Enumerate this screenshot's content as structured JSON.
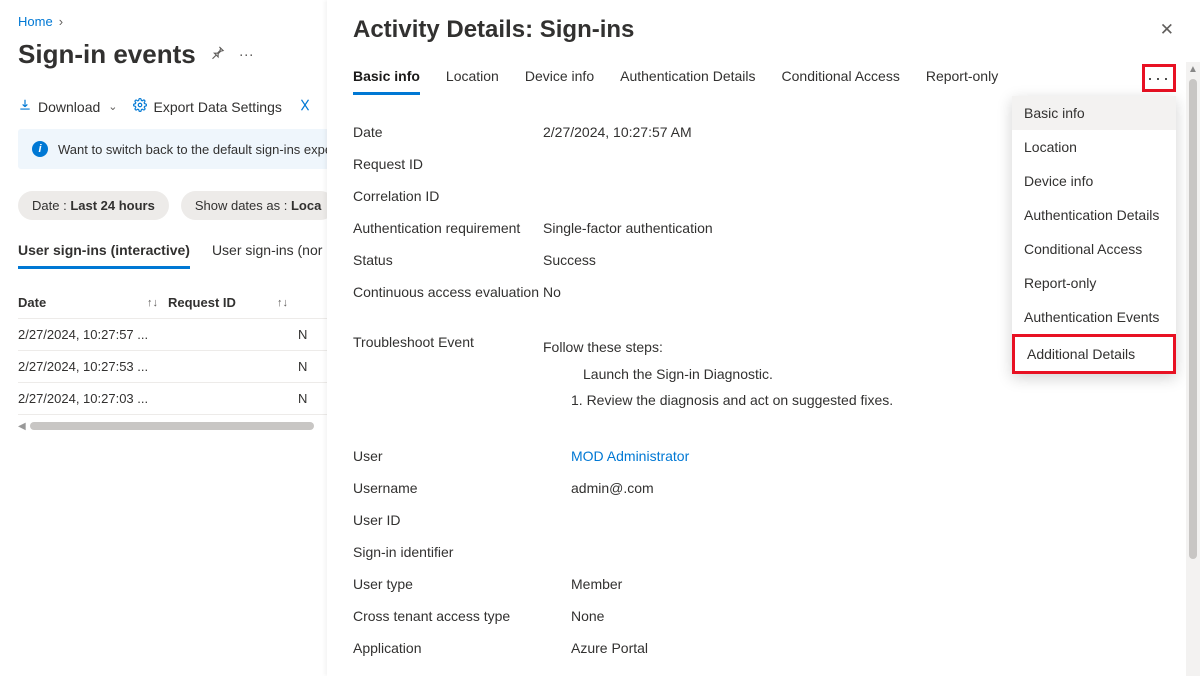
{
  "breadcrumb": {
    "home": "Home"
  },
  "page_title": "Sign-in events",
  "toolbar": {
    "download": "Download",
    "export_settings": "Export Data Settings"
  },
  "banner": "Want to switch back to the default sign-ins experi",
  "filters": {
    "date_label": "Date :",
    "date_value": "Last 24 hours",
    "showdates_label": "Show dates as :",
    "showdates_value": "Loca"
  },
  "subtabs": {
    "interactive": "User sign-ins (interactive)",
    "noninteractive": "User sign-ins (nor"
  },
  "grid": {
    "cols": {
      "date": "Date",
      "request": "Request ID"
    },
    "rows": [
      {
        "date": "2/27/2024, 10:27:57 ...",
        "extra": "N"
      },
      {
        "date": "2/27/2024, 10:27:53 ...",
        "extra": "N"
      },
      {
        "date": "2/27/2024, 10:27:03 ...",
        "extra": "N"
      }
    ]
  },
  "panel": {
    "title": "Activity Details: Sign-ins",
    "tabs": [
      "Basic info",
      "Location",
      "Device info",
      "Authentication Details",
      "Conditional Access",
      "Report-only"
    ],
    "menu_items": [
      "Basic info",
      "Location",
      "Device info",
      "Authentication Details",
      "Conditional Access",
      "Report-only",
      "Authentication Events",
      "Additional Details"
    ],
    "details": {
      "Date": "2/27/2024, 10:27:57 AM",
      "Request ID": "",
      "Correlation ID": "",
      "Authentication requirement": "Single-factor authentication",
      "Status": "Success",
      "Continuous access evaluation": "No"
    },
    "troubleshoot": {
      "label": "Troubleshoot Event",
      "follow": "Follow these steps:",
      "link": "Launch the Sign-in Diagnostic.",
      "step1": "1. Review the diagnosis and act on suggested fixes."
    },
    "details2": {
      "User": "MOD Administrator",
      "Username": "admin@.com",
      "User ID": "",
      "Sign-in identifier": "",
      "User type": "Member",
      "Cross tenant access type": "None",
      "Application": "Azure Portal"
    }
  }
}
